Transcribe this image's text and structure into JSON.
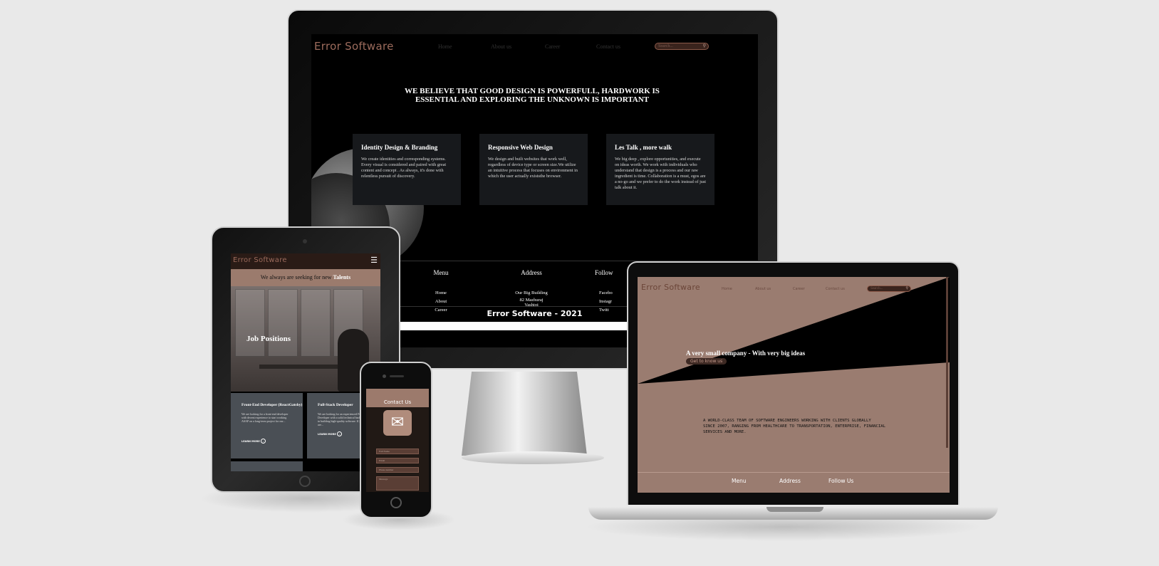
{
  "brand": "Error Software",
  "desktop": {
    "nav": [
      "Home",
      "About us",
      "Career",
      "Contact us"
    ],
    "search_placeholder": "Search...",
    "headline_line1": "WE BELIEVE THAT GOOD DESIGN IS POWERFULL, HARDWORK IS",
    "headline_line2": "ESSENTIAL AND EXPLORING THE UNKNOWN IS IMPORTANT",
    "cards": [
      {
        "title": "Identity Design & Branding",
        "text": "We create identities and corresponding systems. Every visual is considered and paired with great content and concept . As always, it's done with relentless pursuit of discovery."
      },
      {
        "title": "Responsive Web Design",
        "text": "We design and built websites that work well, regardless of device type or screen size.We utilize an intuitive process that focuses on environment in which the user actually existsthe browser."
      },
      {
        "title": "Les Talk , more walk",
        "text": "We big deep , explore opportunities, and execute on ideas worth. We work with individuals who understand that design is a process and our raw ingredient is time. Collaboration is a must, egos are a no-go and we prefer to do the work instead of just talk about it."
      }
    ],
    "footer": {
      "menu_title": "Menu",
      "menu_items": [
        "Home",
        "About",
        "Career"
      ],
      "address_title": "Address",
      "address_lines": [
        "Our Big Building",
        "82 Mazhuraj",
        "Vashtoi"
      ],
      "follow_title": "Follow",
      "follow_items": [
        "Facebo",
        "Instagr",
        "Twitt"
      ],
      "copyright": "Error Software - 2021"
    }
  },
  "tablet": {
    "banner_prefix": "We always are seeking for new",
    "banner_highlight": "Talents",
    "hero_title": "Job Positions",
    "jobs": [
      {
        "title": "Front-End Developer (ReactGatsby)",
        "text": "We are looking for a front-end developer with decent experience to start working ASAP on a long-term project for our...",
        "link": "LEARN MORE"
      },
      {
        "title": "Full-Stack Developer",
        "text": "We are looking for an experienced Full-Stack Developer with a solid technical background in building high-quality software. If you are...",
        "link": "LEARN MORE"
      }
    ]
  },
  "phone": {
    "title": "Contact Us",
    "fields": [
      "Full Name",
      "Email",
      "Phone number",
      "Message"
    ]
  },
  "laptop": {
    "nav": [
      "Home",
      "About us",
      "Career",
      "Contact us"
    ],
    "search_placeholder": "Search...",
    "tagline": "A very small company - With very big ideas",
    "cta": "Get to know us",
    "description_line1": "A WORLD-CLASS TEAM OF SOFTWARE ENGINEERS WORKING WITH CLIENTS GLOBALLY",
    "description_line2": "SINCE 2007, RANGING FROM HEALTHCARE TO TRANSPORTATION, ENTERPRISE, FINANCIAL",
    "description_line3": "SERVICES AND MORE.",
    "footer": [
      "Menu",
      "Address",
      "Follow Us"
    ]
  },
  "colors": {
    "accent": "#9c6b5c",
    "page_bg": "#e9e9e9",
    "laptop_bg": "#9a7c70"
  }
}
